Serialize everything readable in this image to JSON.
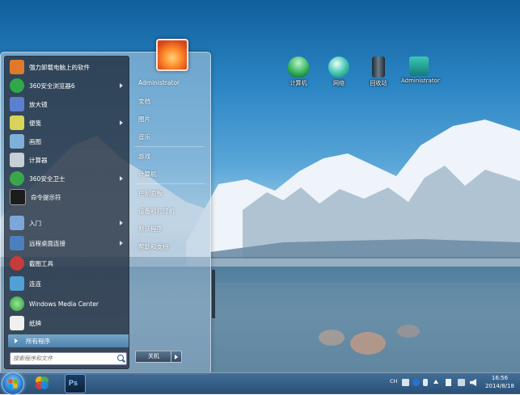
{
  "desktop": {
    "icons": [
      {
        "label": "计算机",
        "icon": "computer-icon"
      },
      {
        "label": "网络",
        "icon": "network-icon"
      },
      {
        "label": "回收站",
        "icon": "recycle-bin-icon"
      },
      {
        "label": "Administrator",
        "icon": "user-folder-icon"
      }
    ]
  },
  "start_menu": {
    "programs": [
      {
        "label": "强力卸载电脑上的软件",
        "icon": "uninstall-icon",
        "color": "#e07a2a",
        "arrow": false
      },
      {
        "label": "360安全浏览器6",
        "icon": "browser-360-icon",
        "color": "#2fa84a",
        "arrow": true
      },
      {
        "label": "放大镜",
        "icon": "magnifier-icon",
        "color": "#5d7fd0",
        "arrow": false
      },
      {
        "label": "便笺",
        "icon": "sticky-notes-icon",
        "color": "#d8d35a",
        "arrow": true
      },
      {
        "label": "画图",
        "icon": "paint-icon",
        "color": "#7fb0d8",
        "arrow": false
      },
      {
        "label": "计算器",
        "icon": "calculator-icon",
        "color": "#c8ced6",
        "arrow": false
      },
      {
        "label": "360安全卫士",
        "icon": "security-360-icon",
        "color": "#3aa64c",
        "arrow": true
      },
      {
        "label": "命令提示符",
        "icon": "cmd-icon",
        "color": "#1c1c1c",
        "arrow": false
      },
      {
        "label": "入门",
        "icon": "getting-started-icon",
        "color": "#7da7d9",
        "arrow": true
      },
      {
        "label": "远程桌面连接",
        "icon": "remote-desktop-icon",
        "color": "#4c7fc0",
        "arrow": true
      },
      {
        "label": "截图工具",
        "icon": "snipping-tool-icon",
        "color": "#c63b3b",
        "arrow": false
      },
      {
        "label": "连连",
        "icon": "sync-icon",
        "color": "#52a0d6",
        "arrow": false
      },
      {
        "label": "Windows Media Center",
        "icon": "media-center-icon",
        "color": "#2c9a3f",
        "arrow": false
      },
      {
        "label": "纸牌",
        "icon": "solitaire-icon",
        "color": "#f0f0f0",
        "arrow": false
      }
    ],
    "all_programs": "所有程序",
    "search_placeholder": "搜索程序和文件",
    "right_items": [
      "Administrator",
      "文档",
      "图片",
      "音乐",
      "游戏",
      "计算机",
      "控制面板",
      "设备和打印机",
      "默认程序",
      "帮助和支持"
    ],
    "shutdown_label": "关机"
  },
  "taskbar": {
    "pinned": [
      {
        "icon": "photos-app-icon"
      },
      {
        "icon": "photoshop-icon",
        "label": "Ps"
      }
    ],
    "tray_icons": [
      "ch-language-icon",
      "keyboard-icon",
      "help-icon",
      "pen-icon",
      "arrow-up-icon",
      "flag-icon",
      "network-icon",
      "volume-icon"
    ],
    "tray_text": {
      "lang": "CH"
    },
    "clock": {
      "time": "16:56",
      "date": "2014/8/18"
    }
  }
}
